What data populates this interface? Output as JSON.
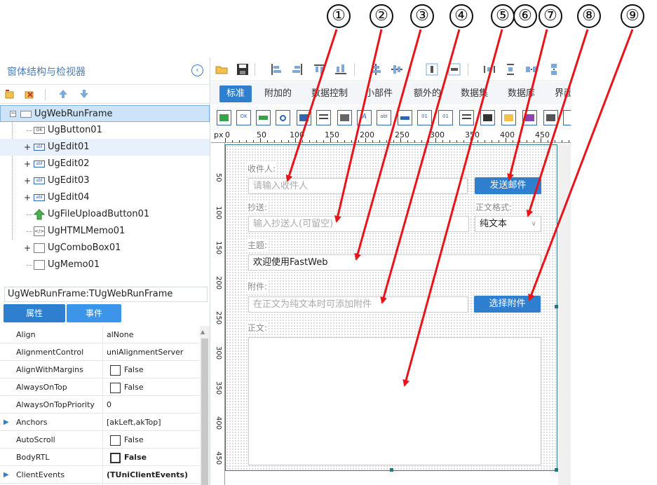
{
  "panel_title": "窗体结构与检视器",
  "tree": {
    "items": [
      {
        "label": "UgWebRunFrame"
      },
      {
        "label": "UgButton01"
      },
      {
        "label": "UgEdit01"
      },
      {
        "label": "UgEdit02"
      },
      {
        "label": "UgEdit03"
      },
      {
        "label": "UgEdit04"
      },
      {
        "label": "UgFileUploadButton01"
      },
      {
        "label": "UgHTMLMemo01"
      },
      {
        "label": "UgComboBox01"
      },
      {
        "label": "UgMemo01"
      }
    ]
  },
  "inspector": {
    "title": "UgWebRunFrame:TUgWebRunFrame",
    "tab_props": "属性",
    "tab_events": "事件",
    "props": [
      {
        "name": "Align",
        "value": "alNone"
      },
      {
        "name": "AlignmentControl",
        "value": "uniAlignmentServer"
      },
      {
        "name": "AlignWithMargins",
        "value": "False"
      },
      {
        "name": "AlwaysOnTop",
        "value": "False"
      },
      {
        "name": "AlwaysOnTopPriority",
        "value": "0"
      },
      {
        "name": "Anchors",
        "value": "[akLeft,akTop]"
      },
      {
        "name": "AutoScroll",
        "value": "False"
      },
      {
        "name": "BodyRTL",
        "value": "False"
      },
      {
        "name": "ClientEvents",
        "value": "(TUniClientEvents)"
      }
    ]
  },
  "component_tabs": [
    "标准",
    "附加的",
    "数据控制",
    "小部件",
    "额外的",
    "数据集",
    "数据库",
    "界面"
  ],
  "palette_labels": {
    "edit": "abl",
    "button": "OK"
  },
  "ruler": {
    "top": [
      "px",
      "0",
      "50",
      "100",
      "150",
      "200",
      "250",
      "300",
      "350",
      "400",
      "450"
    ],
    "left": [
      "50",
      "100",
      "150",
      "200",
      "250",
      "300",
      "350",
      "400",
      "450"
    ]
  },
  "form": {
    "recipient_label": "收件人:",
    "recipient_placeholder": "请输入收件人",
    "send_button": "发送邮件",
    "cc_label": "抄送:",
    "cc_placeholder": "输入抄送人(可留空)",
    "format_label": "正文格式:",
    "format_value": "纯文本",
    "subject_label": "主题:",
    "subject_value": "欢迎使用FastWeb",
    "attach_label": "附件:",
    "attach_placeholder": "在正文为纯文本时可添加附件",
    "attach_button": "选择附件",
    "body_label": "正文:"
  },
  "annotations": [
    "①",
    "②",
    "③",
    "④",
    "⑤",
    "⑥",
    "⑦",
    "⑧",
    "⑨"
  ],
  "colors": {
    "accent": "#2f7fd1",
    "arrow": "#e8141a",
    "title": "#4a7fb5"
  }
}
